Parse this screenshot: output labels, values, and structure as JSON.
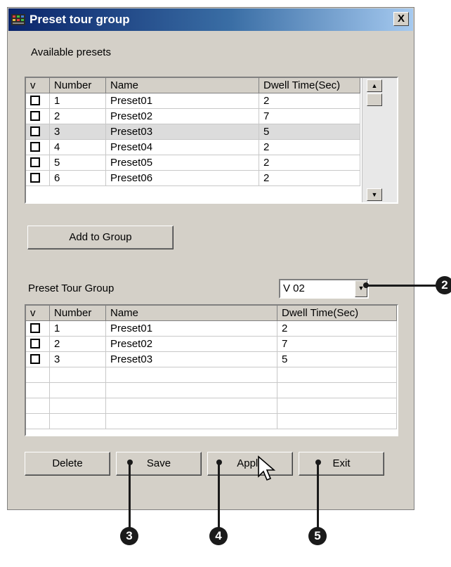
{
  "window": {
    "title": "Preset tour group",
    "close_label": "X"
  },
  "available": {
    "label": "Available presets",
    "columns": [
      "v",
      "Number",
      "Name",
      "Dwell Time(Sec)"
    ],
    "rows": [
      {
        "number": "1",
        "name": "Preset01",
        "dwell": "2"
      },
      {
        "number": "2",
        "name": "Preset02",
        "dwell": "7"
      },
      {
        "number": "3",
        "name": "Preset03",
        "dwell": "5"
      },
      {
        "number": "4",
        "name": "Preset04",
        "dwell": "2"
      },
      {
        "number": "5",
        "name": "Preset05",
        "dwell": "2"
      },
      {
        "number": "6",
        "name": "Preset06",
        "dwell": "2"
      }
    ]
  },
  "add_button": "Add to Group",
  "group": {
    "label": "Preset Tour Group",
    "selected": "V 02",
    "columns": [
      "v",
      "Number",
      "Name",
      "Dwell Time(Sec)"
    ],
    "rows": [
      {
        "number": "1",
        "name": "Preset01",
        "dwell": "2"
      },
      {
        "number": "2",
        "name": "Preset02",
        "dwell": "7"
      },
      {
        "number": "3",
        "name": "Preset03",
        "dwell": "5"
      }
    ]
  },
  "buttons": {
    "delete": "Delete",
    "save": "Save",
    "apply": "Apply",
    "exit": "Exit"
  },
  "callouts": {
    "c2": "2",
    "c3": "3",
    "c4": "4",
    "c5": "5"
  },
  "icons": {
    "scroll_up": "▲",
    "scroll_down": "▼",
    "combo": "▼"
  }
}
